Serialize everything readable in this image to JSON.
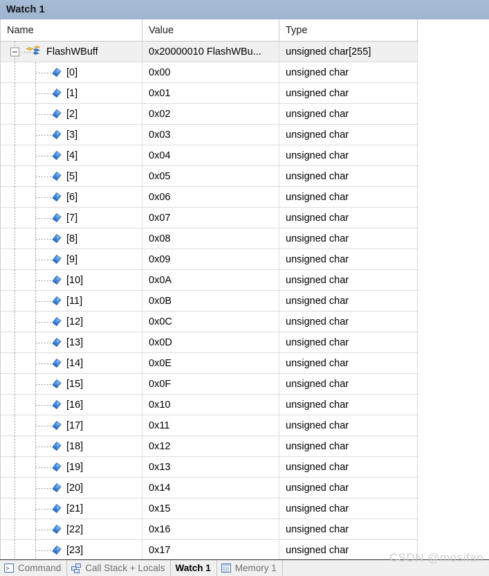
{
  "window": {
    "title": "Watch 1"
  },
  "colors": {
    "titlebar": "#a3b8d2",
    "selected_row": "#f0f0f0",
    "grid_line": "#dcdcdc",
    "icon_blue": "#3a7fd5",
    "icon_yellow": "#f2c14b",
    "watermark": "#cfcfcf"
  },
  "grid": {
    "columns": [
      {
        "key": "name",
        "label": "Name"
      },
      {
        "key": "value",
        "label": "Value"
      },
      {
        "key": "type",
        "label": "Type"
      }
    ],
    "rows": [
      {
        "name": "FlashWBuff",
        "value": "0x20000010 FlashWBu...",
        "type": "unsigned char[255]",
        "level": 0,
        "icon": "array-icon",
        "expanded": true,
        "selected": true
      },
      {
        "name": "[0]",
        "value": "0x00",
        "type": "unsigned char",
        "level": 1,
        "icon": "diamond-icon",
        "selected": false
      },
      {
        "name": "[1]",
        "value": "0x01",
        "type": "unsigned char",
        "level": 1,
        "icon": "diamond-icon",
        "selected": false
      },
      {
        "name": "[2]",
        "value": "0x02",
        "type": "unsigned char",
        "level": 1,
        "icon": "diamond-icon",
        "selected": false
      },
      {
        "name": "[3]",
        "value": "0x03",
        "type": "unsigned char",
        "level": 1,
        "icon": "diamond-icon",
        "selected": false
      },
      {
        "name": "[4]",
        "value": "0x04",
        "type": "unsigned char",
        "level": 1,
        "icon": "diamond-icon",
        "selected": false
      },
      {
        "name": "[5]",
        "value": "0x05",
        "type": "unsigned char",
        "level": 1,
        "icon": "diamond-icon",
        "selected": false
      },
      {
        "name": "[6]",
        "value": "0x06",
        "type": "unsigned char",
        "level": 1,
        "icon": "diamond-icon",
        "selected": false
      },
      {
        "name": "[7]",
        "value": "0x07",
        "type": "unsigned char",
        "level": 1,
        "icon": "diamond-icon",
        "selected": false
      },
      {
        "name": "[8]",
        "value": "0x08",
        "type": "unsigned char",
        "level": 1,
        "icon": "diamond-icon",
        "selected": false
      },
      {
        "name": "[9]",
        "value": "0x09",
        "type": "unsigned char",
        "level": 1,
        "icon": "diamond-icon",
        "selected": false
      },
      {
        "name": "[10]",
        "value": "0x0A",
        "type": "unsigned char",
        "level": 1,
        "icon": "diamond-icon",
        "selected": false
      },
      {
        "name": "[11]",
        "value": "0x0B",
        "type": "unsigned char",
        "level": 1,
        "icon": "diamond-icon",
        "selected": false
      },
      {
        "name": "[12]",
        "value": "0x0C",
        "type": "unsigned char",
        "level": 1,
        "icon": "diamond-icon",
        "selected": false
      },
      {
        "name": "[13]",
        "value": "0x0D",
        "type": "unsigned char",
        "level": 1,
        "icon": "diamond-icon",
        "selected": false
      },
      {
        "name": "[14]",
        "value": "0x0E",
        "type": "unsigned char",
        "level": 1,
        "icon": "diamond-icon",
        "selected": false
      },
      {
        "name": "[15]",
        "value": "0x0F",
        "type": "unsigned char",
        "level": 1,
        "icon": "diamond-icon",
        "selected": false
      },
      {
        "name": "[16]",
        "value": "0x10",
        "type": "unsigned char",
        "level": 1,
        "icon": "diamond-icon",
        "selected": false
      },
      {
        "name": "[17]",
        "value": "0x11",
        "type": "unsigned char",
        "level": 1,
        "icon": "diamond-icon",
        "selected": false
      },
      {
        "name": "[18]",
        "value": "0x12",
        "type": "unsigned char",
        "level": 1,
        "icon": "diamond-icon",
        "selected": false
      },
      {
        "name": "[19]",
        "value": "0x13",
        "type": "unsigned char",
        "level": 1,
        "icon": "diamond-icon",
        "selected": false
      },
      {
        "name": "[20]",
        "value": "0x14",
        "type": "unsigned char",
        "level": 1,
        "icon": "diamond-icon",
        "selected": false
      },
      {
        "name": "[21]",
        "value": "0x15",
        "type": "unsigned char",
        "level": 1,
        "icon": "diamond-icon",
        "selected": false
      },
      {
        "name": "[22]",
        "value": "0x16",
        "type": "unsigned char",
        "level": 1,
        "icon": "diamond-icon",
        "selected": false
      },
      {
        "name": "[23]",
        "value": "0x17",
        "type": "unsigned char",
        "level": 1,
        "icon": "diamond-icon",
        "selected": false
      }
    ]
  },
  "tabs": [
    {
      "label": "Command",
      "icon": "command-prompt-icon",
      "active": false
    },
    {
      "label": "Call Stack + Locals",
      "icon": "call-stack-icon",
      "active": false
    },
    {
      "label": "Watch 1",
      "icon": "",
      "active": true
    },
    {
      "label": "Memory 1",
      "icon": "memory-grid-icon",
      "active": false
    }
  ],
  "watermark": {
    "text": "CSDN @mosifan"
  }
}
